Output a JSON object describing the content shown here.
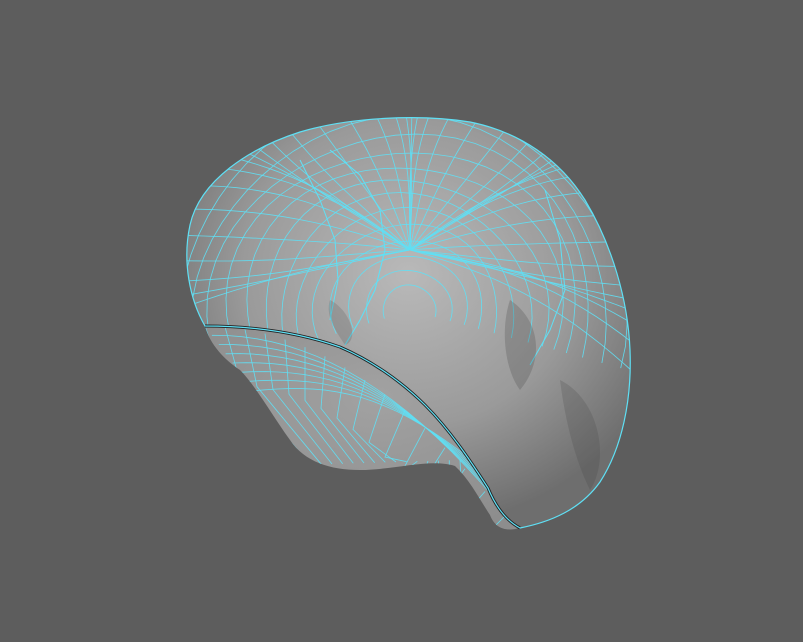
{
  "viewport": {
    "background_color": "#5d5d5d",
    "object": {
      "kind": "polygon-mesh-hair-cap",
      "display_mode": "shaded-with-wireframe",
      "wireframe_color": "#5fe0f5",
      "surface_color_light": "#b9b9b9",
      "surface_color_mid": "#9a9a9a",
      "surface_color_dark": "#6e6e6e",
      "underside_color": "#8d8d8d",
      "edge_shadow_color": "#222222"
    }
  }
}
